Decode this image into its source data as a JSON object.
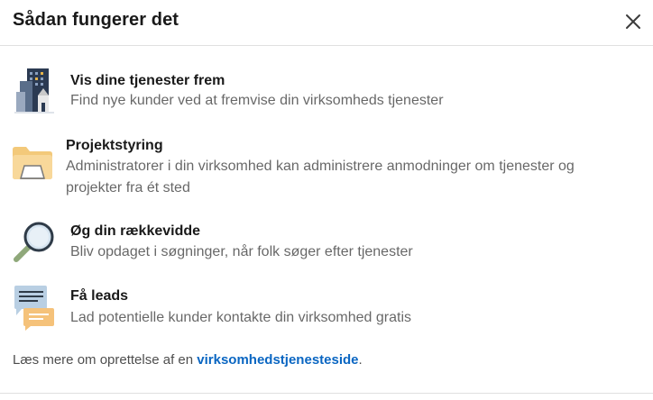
{
  "dialog": {
    "title": "Sådan fungerer det",
    "close_icon": "close-icon"
  },
  "items": [
    {
      "icon": "buildings-icon",
      "heading": "Vis dine tjenester frem",
      "desc_lines": [
        "Find nye kunder ved at fremvise din virksomheds tjenester"
      ]
    },
    {
      "icon": "folder-icon",
      "heading": "Projektstyring",
      "desc_lines": [
        "Administratorer i din virksomhed kan administrere anmodninger om tjenester og",
        "projekter fra ét sted"
      ]
    },
    {
      "icon": "magnifier-icon",
      "heading": "Øg din rækkevidde",
      "desc_lines": [
        "Bliv opdaget i søgninger, når folk søger efter tjenester"
      ]
    },
    {
      "icon": "chat-bubbles-icon",
      "heading": "Få leads",
      "desc_lines": [
        "Lad potentielle kunder kontakte din virksomhed gratis"
      ]
    }
  ],
  "footer": {
    "prefix": "Læs mere om oprettelse af en ",
    "link": "virksomhedstjenesteside",
    "suffix": "."
  },
  "colors": {
    "link": "#0a66c2",
    "divider": "#e0e0e0"
  }
}
